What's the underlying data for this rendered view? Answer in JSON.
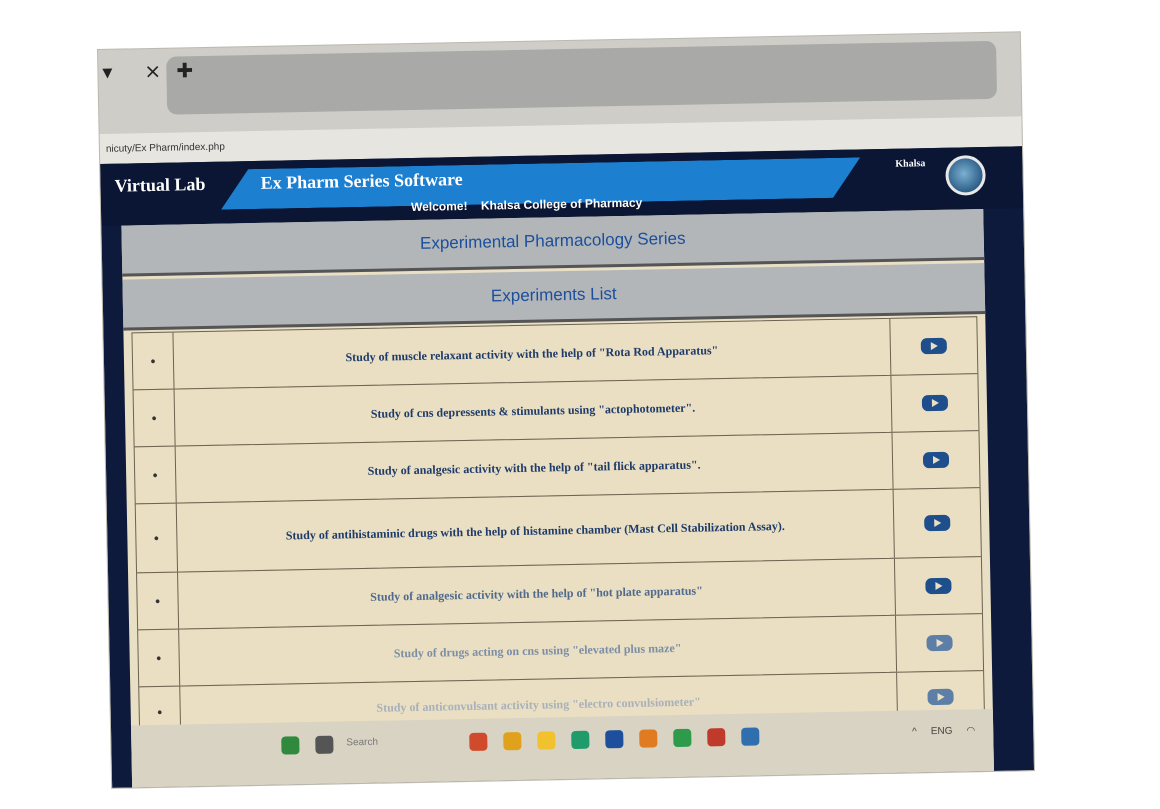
{
  "browser": {
    "url": "nicuty/Ex Pharm/index.php",
    "tab_controls": [
      "▾",
      "⨯",
      "✚"
    ]
  },
  "header": {
    "brand": "Virtual Lab",
    "title": "Ex Pharm Series Software",
    "welcome_label": "Welcome!",
    "college": "Khalsa College of Pharmacy",
    "user": "Khalsa"
  },
  "bands": {
    "series": "Experimental Pharmacology Series",
    "list": "Experiments List"
  },
  "experiments": [
    {
      "title": "Study of muscle relaxant activity with the help of \"Rota Rod Apparatus\""
    },
    {
      "title": "Study of cns depressents & stimulants using \"actophotometer\"."
    },
    {
      "title": "Study of analgesic activity with the help of \"tail flick apparatus\"."
    },
    {
      "title": "Study of antihistaminic drugs with the help of histamine chamber (Mast Cell Stabilization Assay)."
    },
    {
      "title": "Study of analgesic activity with the help of \"hot plate apparatus\""
    },
    {
      "title": "Study of drugs acting on cns using \"elevated plus maze\""
    },
    {
      "title": "Study of anticonvulsant activity using \"electro convulsiometer\""
    }
  ],
  "taskbar": {
    "search": "Search",
    "lang": "ENG",
    "icon_colors": [
      "#2f8a3d",
      "#555555",
      "#d04b2b",
      "#e0a21c",
      "#f2c12e",
      "#1f9b6c",
      "#1d4f9c",
      "#e07b22",
      "#2d9b4a",
      "#c03a2b",
      "#2f6fb0"
    ]
  }
}
